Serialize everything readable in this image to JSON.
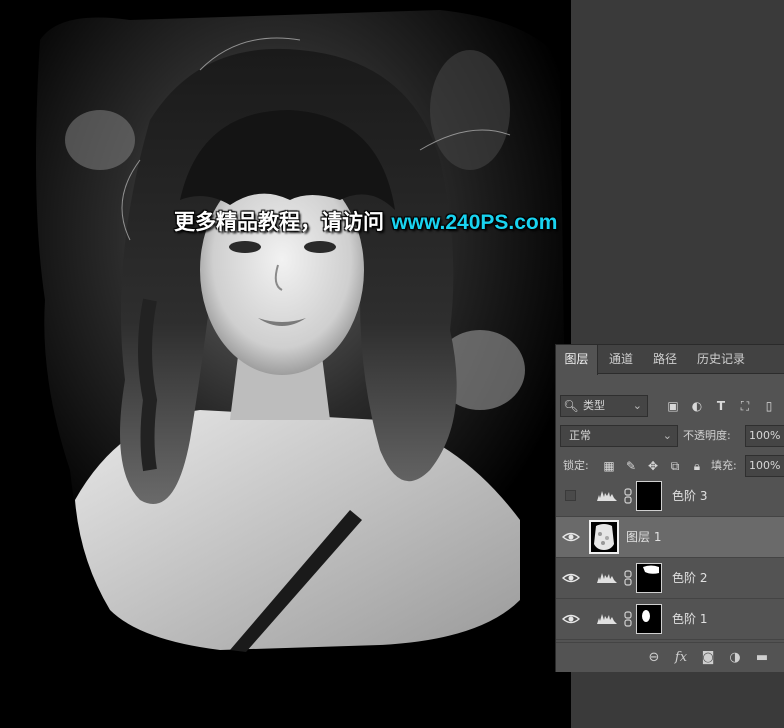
{
  "watermark": {
    "text_cn": "更多精品教程，请访问",
    "url": "www.240PS.com"
  },
  "layers_panel": {
    "tabs": [
      {
        "label": "图层",
        "active": true
      },
      {
        "label": "通道",
        "active": false
      },
      {
        "label": "路径",
        "active": false
      },
      {
        "label": "历史记录",
        "active": false
      }
    ],
    "filter": {
      "kind_label": "类型"
    },
    "blend_mode": "正常",
    "opacity_label": "不透明度:",
    "opacity_value": "100%",
    "lock_label": "锁定:",
    "fill_label": "填充:",
    "fill_value": "100%",
    "layers": [
      {
        "name": "色阶 3",
        "type": "levels",
        "visible": false,
        "selected": false
      },
      {
        "name": "图层 1",
        "type": "pixel",
        "visible": true,
        "selected": true
      },
      {
        "name": "色阶 2",
        "type": "levels",
        "visible": true,
        "selected": false
      },
      {
        "name": "色阶 1",
        "type": "levels",
        "visible": true,
        "selected": false
      }
    ],
    "footer_icons": [
      "link-layers-icon",
      "fx-icon",
      "add-mask-icon",
      "adjustment-layer-icon",
      "group-folder-icon"
    ]
  },
  "colors": {
    "watermark_url": "#19d3f0",
    "panel_bg": "#535353",
    "selected_row": "#6a6a6a"
  }
}
